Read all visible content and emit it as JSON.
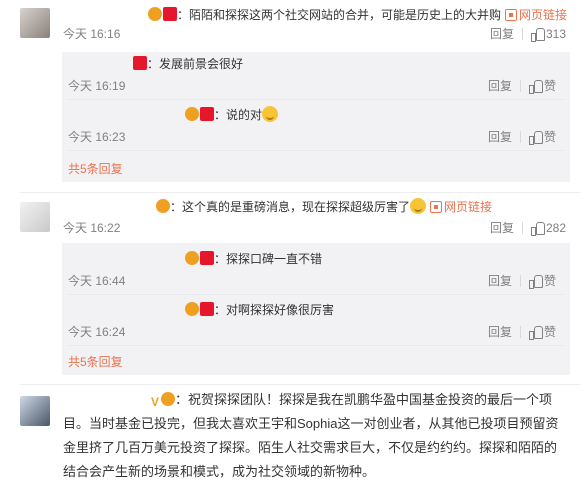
{
  "comments": [
    {
      "text": "：陌陌和探探这两个社交网站的合并，可能是历史上的大并购",
      "weblink": "网页链接",
      "time": "今天 16:16",
      "reply_label": "回复",
      "like_count": "313",
      "replies": [
        {
          "text": "：发展前景会很好",
          "time": "今天 16:19",
          "reply_label": "回复",
          "like_label": "赞"
        },
        {
          "text": "：说的对",
          "time": "今天 16:23",
          "reply_label": "回复",
          "like_label": "赞"
        }
      ],
      "more_replies": "共5条回复"
    },
    {
      "text": "：这个真的是重磅消息，现在探探超级厉害了",
      "weblink": "网页链接",
      "time": "今天 16:22",
      "reply_label": "回复",
      "like_count": "282",
      "replies": [
        {
          "text": "：探探口碑一直不错",
          "time": "今天 16:44",
          "reply_label": "回复",
          "like_label": "赞"
        },
        {
          "text": "：对啊探探好像很厉害",
          "time": "今天 16:24",
          "reply_label": "回复",
          "like_label": "赞"
        }
      ],
      "more_replies": "共5条回复"
    },
    {
      "text": "：祝贺探探团队！探探是我在凯鹏华盈中国基金投资的最后一个项目。当时基金已投完，但我太喜欢王宇和Sophia这一对创业者，从其他已投项目预留资金里挤了几百万美元投资了探探。陌生人社交需求巨大，不仅是约约约。探探和陌陌的结合会产生新的场景和模式，成为社交领域的新物种。"
    }
  ],
  "icons": {
    "verified": "V",
    "badge_colors": {
      "red": "#e6162d",
      "gold": "#f0a020"
    },
    "link_color": "#eb7350"
  }
}
